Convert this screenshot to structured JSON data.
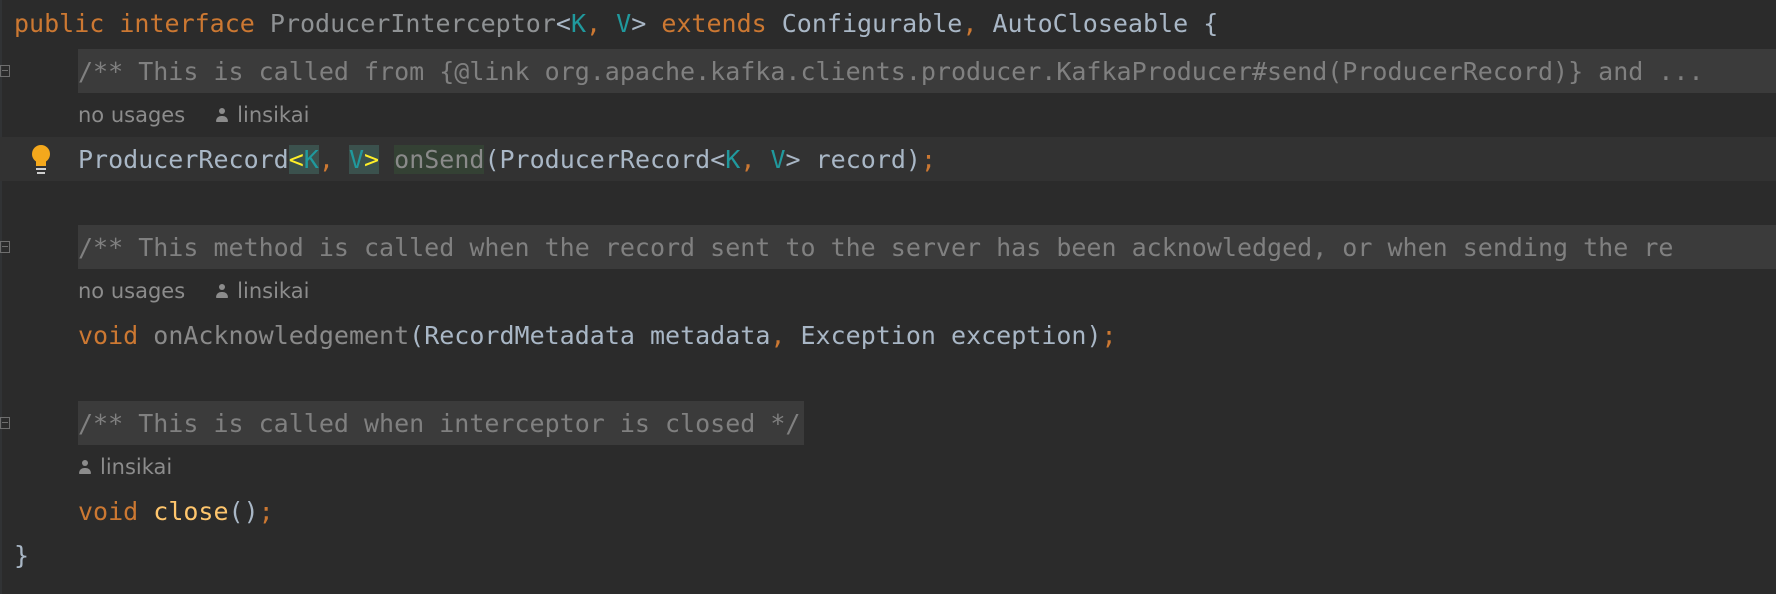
{
  "code": {
    "line1": {
      "kw_public": "public",
      "kw_interface": "interface",
      "name": "ProducerInterceptor",
      "lt": "<",
      "tK": "K",
      "comma": ", ",
      "tV": "V",
      "gt": ">",
      "kw_extends": "extends",
      "super1": "Configurable",
      "comma2": ", ",
      "super2": "AutoCloseable",
      "brace": " {"
    },
    "doc1": "/** This is called from {@link org.apache.kafka.clients.producer.KafkaProducer#send(ProducerRecord)} and ...",
    "hint1": {
      "usages": "no usages",
      "author": "linsikai"
    },
    "onSend": {
      "ret": "ProducerRecord",
      "lt": "<",
      "tK": "K",
      "comma": ", ",
      "tV": "V",
      "gt": ">",
      "name": "onSend",
      "open": "(ProducerRecord<",
      "pK": "K",
      "pcomma": ", ",
      "pV": "V",
      "rest": "> record)",
      "semi": ";"
    },
    "doc2": "/** This method is called when the record sent to the server has been acknowledged, or when sending the re",
    "hint2": {
      "usages": "no usages",
      "author": "linsikai"
    },
    "onAck": {
      "kw_void": "void",
      "name": "onAcknowledgement",
      "p1": "(RecordMetadata metadata",
      "comma": ",",
      "p2": " Exception exception)",
      "semi": ";"
    },
    "doc3": "/** This is called when interceptor is closed */",
    "hint3": {
      "author": "linsikai"
    },
    "close": {
      "kw_void": "void",
      "name": "close",
      "parens": "()",
      "semi": ";"
    },
    "end_brace": "}"
  },
  "icons": {
    "intention": "lightbulb-icon",
    "fold": "fold-icon",
    "author": "person-icon"
  },
  "colors": {
    "background": "#2b2b2b",
    "keyword": "#cc7832",
    "type_param": "#20999d",
    "method_decl": "#ffc66d",
    "comment": "#808080",
    "bracket_match": "#ffef28"
  }
}
